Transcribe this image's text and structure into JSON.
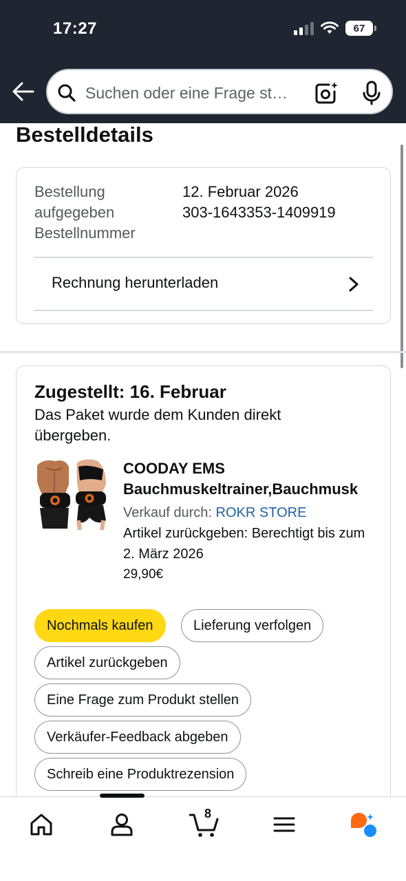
{
  "status_bar": {
    "time": "17:27",
    "battery": "67"
  },
  "search": {
    "placeholder": "Suchen oder eine Frage st…"
  },
  "page": {
    "title": "Bestelldetails"
  },
  "order_summary": {
    "placed_label": "Bestellung aufgegeben",
    "placed_date": "12. Februar 2026",
    "number_label": "Bestellnummer",
    "number": "303-1643353-1409919",
    "invoice_label": "Rechnung herunterladen"
  },
  "shipment": {
    "status_title": "Zugestellt: 16. Februar",
    "status_detail": "Das Paket wurde dem Kunden direkt übergeben.",
    "product": {
      "title_line1": "COODAY EMS",
      "title_line2": "Bauchmuskeltrainer,Bauchmusk",
      "seller_prefix": "Verkauf durch:",
      "seller_name": "ROKR STORE",
      "return_info": "Artikel zurückgeben: Berechtigt bis zum 2. März 2026",
      "price": "29,90€"
    },
    "actions": {
      "buy_again": "Nochmals kaufen",
      "track": "Lieferung verfolgen",
      "return_item": "Artikel zurückgeben",
      "ask_question": "Eine Frage zum Produkt stellen",
      "seller_feedback": "Verkäufer-Feedback abgeben",
      "write_review": "Schreib eine Produktrezension"
    }
  },
  "bottom_nav": {
    "cart_count": "8",
    "items": [
      "home-icon",
      "account-icon",
      "cart-icon",
      "menu-icon",
      "rufus-assistant-icon"
    ]
  },
  "colors": {
    "header_bg": "#1f2632",
    "buy_again_bg": "#ffd814",
    "link": "#2162a1",
    "assistant_orange": "#ff6a13",
    "assistant_blue": "#1a8cff"
  }
}
